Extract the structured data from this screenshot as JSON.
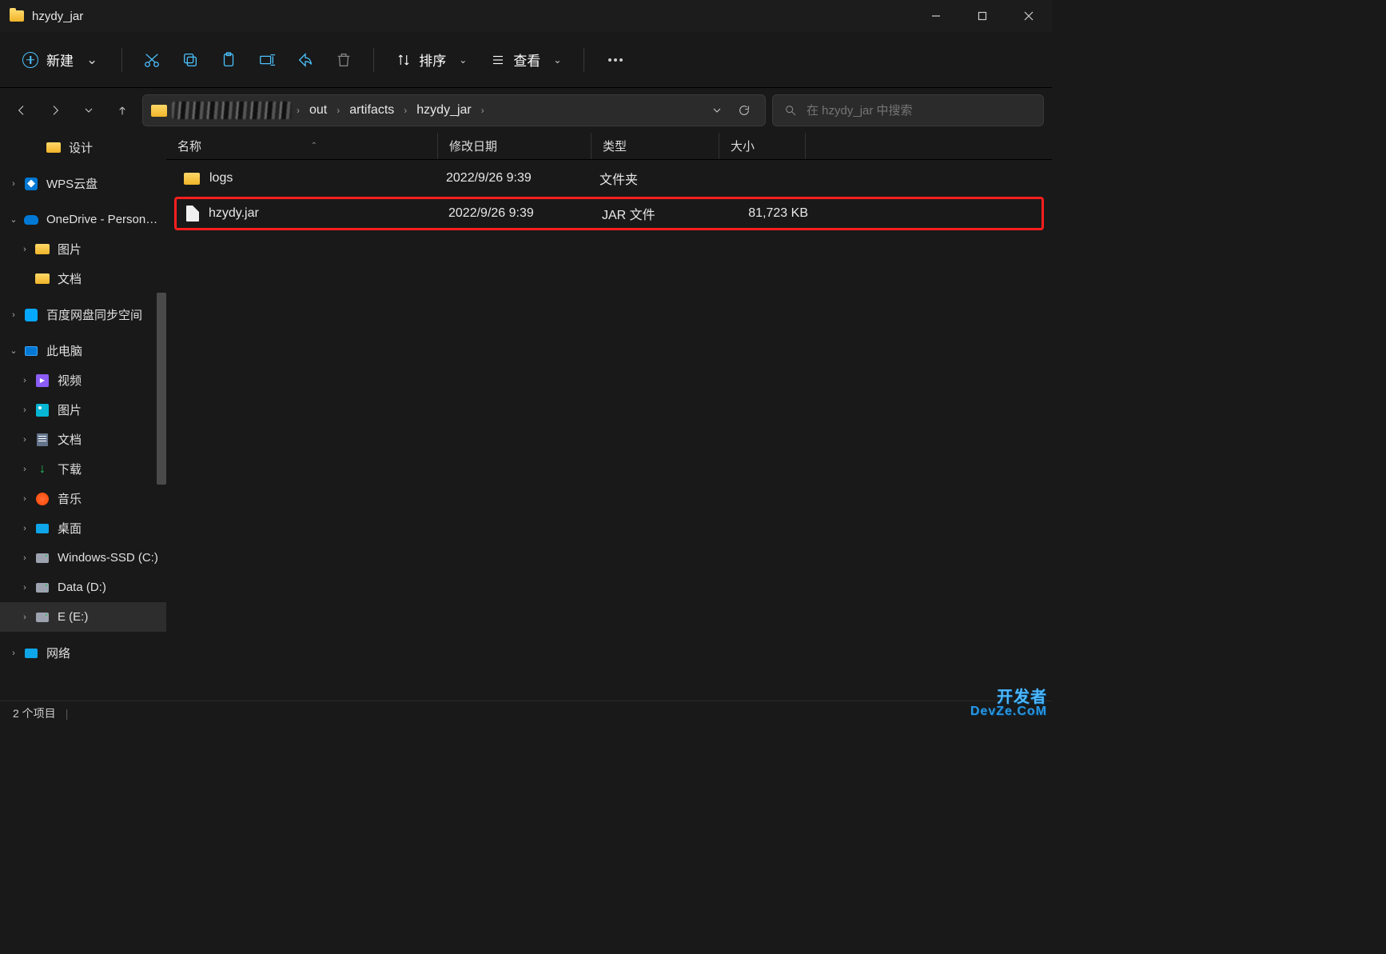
{
  "window": {
    "title": "hzydy_jar"
  },
  "toolbar": {
    "new_label": "新建",
    "sort_label": "排序",
    "view_label": "查看"
  },
  "breadcrumb": {
    "segments": [
      "out",
      "artifacts",
      "hzydy_jar"
    ]
  },
  "search": {
    "placeholder": "在 hzydy_jar 中搜索"
  },
  "columns": {
    "name": "名称",
    "date": "修改日期",
    "type": "类型",
    "size": "大小"
  },
  "files": [
    {
      "name": "logs",
      "date": "2022/9/26 9:39",
      "type": "文件夹",
      "size": "",
      "icon": "folder",
      "highlight": false
    },
    {
      "name": "hzydy.jar",
      "date": "2022/9/26 9:39",
      "type": "JAR 文件",
      "size": "81,723 KB",
      "icon": "file",
      "highlight": true
    }
  ],
  "sidebar": [
    {
      "label": "设计",
      "icon": "folder",
      "depth": 2,
      "expander": ""
    },
    {
      "label": "WPS云盘",
      "icon": "wps",
      "depth": 0,
      "expander": "›"
    },
    {
      "label": "OneDrive - Person…",
      "icon": "onedrive",
      "depth": 0,
      "expander": "⌄"
    },
    {
      "label": "图片",
      "icon": "folder",
      "depth": 1,
      "expander": "›"
    },
    {
      "label": "文档",
      "icon": "folder",
      "depth": 1,
      "expander": ""
    },
    {
      "label": "百度网盘同步空间",
      "icon": "baidu",
      "depth": 0,
      "expander": "›"
    },
    {
      "label": "此电脑",
      "icon": "pc",
      "depth": 0,
      "expander": "⌄"
    },
    {
      "label": "视频",
      "icon": "video",
      "depth": 1,
      "expander": "›"
    },
    {
      "label": "图片",
      "icon": "pic",
      "depth": 1,
      "expander": "›"
    },
    {
      "label": "文档",
      "icon": "doc",
      "depth": 1,
      "expander": "›"
    },
    {
      "label": "下载",
      "icon": "dl",
      "depth": 1,
      "expander": "›"
    },
    {
      "label": "音乐",
      "icon": "music",
      "depth": 1,
      "expander": "›"
    },
    {
      "label": "桌面",
      "icon": "desktop",
      "depth": 1,
      "expander": "›"
    },
    {
      "label": "Windows-SSD (C:)",
      "icon": "drive",
      "depth": 1,
      "expander": "›"
    },
    {
      "label": "Data (D:)",
      "icon": "drive",
      "depth": 1,
      "expander": "›"
    },
    {
      "label": "E (E:)",
      "icon": "drive",
      "depth": 1,
      "expander": "›",
      "selected": true
    },
    {
      "label": "网络",
      "icon": "net",
      "depth": 0,
      "expander": "›"
    }
  ],
  "statusbar": {
    "text": "2 个项目"
  },
  "watermark": {
    "line1": "开发者",
    "line2": "DevZe.CoM"
  }
}
